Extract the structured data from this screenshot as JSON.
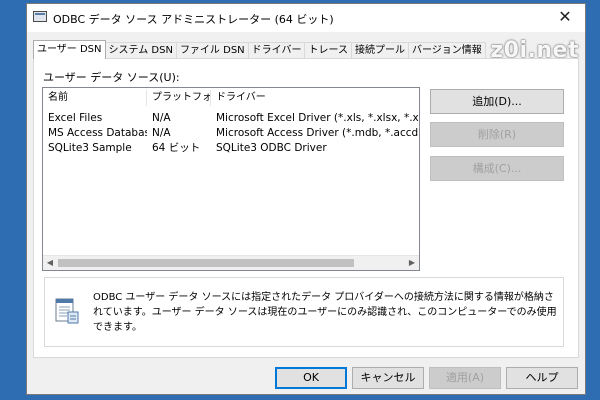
{
  "window": {
    "title": "ODBC データ ソース アドミニストレーター (64 ビット)",
    "close_glyph": "✕",
    "watermark": "z0i.net"
  },
  "tabs": [
    {
      "label": "ユーザー DSN",
      "active": true
    },
    {
      "label": "システム DSN"
    },
    {
      "label": "ファイル DSN"
    },
    {
      "label": "ドライバー"
    },
    {
      "label": "トレース"
    },
    {
      "label": "接続プール"
    },
    {
      "label": "バージョン情報"
    }
  ],
  "user_dsn": {
    "section_label": "ユーザー データ ソース(U):",
    "columns": [
      "名前",
      "プラットフォーム",
      "ドライバー"
    ],
    "rows": [
      {
        "name": "Excel Files",
        "platform": "N/A",
        "driver": "Microsoft Excel Driver (*.xls, *.xlsx, *.xlsm"
      },
      {
        "name": "MS Access Database",
        "platform": "N/A",
        "driver": "Microsoft Access Driver (*.mdb, *.accdb)"
      },
      {
        "name": "SQLite3 Sample",
        "platform": "64 ビット",
        "driver": "SQLite3 ODBC Driver"
      }
    ],
    "scroll_left_glyph": "◀",
    "scroll_right_glyph": "▶",
    "buttons": {
      "add": "追加(D)...",
      "remove": "削除(R)",
      "configure": "構成(C)..."
    },
    "info_text": "ODBC ユーザー データ ソースには指定されたデータ プロバイダーへの接続方法に関する情報が格納されています。ユーザー データ ソースは現在のユーザーにのみ認識され、このコンピューターでのみ使用できます。",
    "info_icon": "data-source-icon"
  },
  "footer": {
    "ok": "OK",
    "cancel": "キャンセル",
    "apply": "適用(A)",
    "help": "ヘルプ"
  },
  "colors": {
    "desktop": "#2f6db3",
    "dialog": "#f0f0f0",
    "default_button_border": "#0078d7"
  }
}
